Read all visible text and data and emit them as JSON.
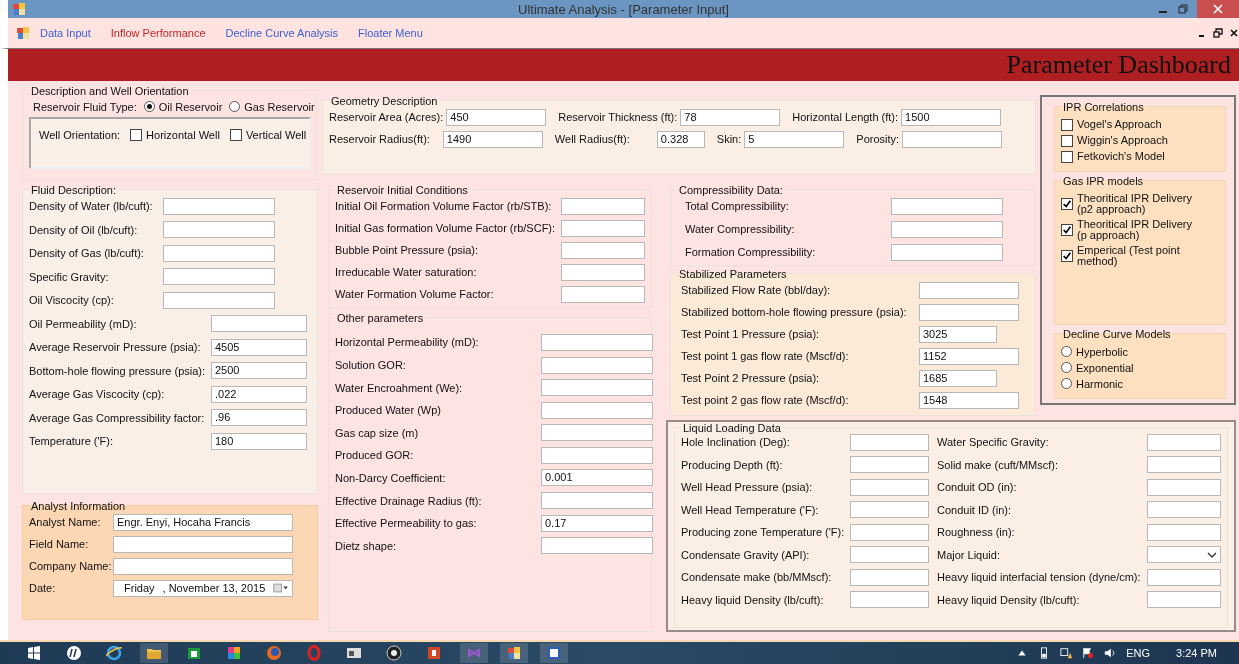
{
  "window": {
    "title": "Ultimate Analysis - [Parameter Input]"
  },
  "menu": [
    {
      "label": "Data Input",
      "selected": false
    },
    {
      "label": "Inflow Performance",
      "selected": true
    },
    {
      "label": "Decline Curve Analysis",
      "selected": false
    },
    {
      "label": "Floater Menu",
      "selected": false
    }
  ],
  "banner": {
    "title": "Parameter Dashboard"
  },
  "description": {
    "title": "Description and Well Orientation",
    "fluid_type_label": "Reservoir Fluid Type:",
    "fluid_types": [
      {
        "label": "Oil Reservoir",
        "selected": true
      },
      {
        "label": "Gas Reservoir",
        "selected": false
      }
    ],
    "orientation_label": "Well Orientation:",
    "orientations": [
      {
        "label": "Horizontal Well",
        "checked": false
      },
      {
        "label": "Vertical Well",
        "checked": false
      }
    ]
  },
  "geometry": {
    "title": "Geometry Description",
    "fields": [
      {
        "label": "Reservoir Area (Acres):",
        "value": "450"
      },
      {
        "label": "Reservoir Thickness (ft):",
        "value": "78"
      },
      {
        "label": "Horizontal Length (ft):",
        "value": "1500"
      },
      {
        "label": "Reservoir Radius(ft):",
        "value": "1490"
      },
      {
        "label": "Well Radius(ft):",
        "value": "0.328"
      },
      {
        "label": "Skin:",
        "value": "5"
      },
      {
        "label": "Porosity:"
      }
    ]
  },
  "fluid": {
    "title": "Fluid Description:",
    "fields": [
      {
        "label": "Density of Water (lb/cuft):"
      },
      {
        "label": "Density of Oil (lb/cuft):"
      },
      {
        "label": "Density of Gas (lb/cuft):"
      },
      {
        "label": "Specific Gravity:"
      },
      {
        "label": "Oil Viscocity (cp):"
      },
      {
        "label": "Oil Permeability (mD):"
      },
      {
        "label": "Average Reservoir Pressure (psia):",
        "value": "4505"
      },
      {
        "label": "Bottom-hole flowing pressure (psia):",
        "value": "2500"
      },
      {
        "label": "Average Gas Viscocity (cp):",
        "value": ".022"
      },
      {
        "label": "Average Gas Compressibility factor:",
        "value": ".96"
      },
      {
        "label": "Temperature ('F):",
        "value": "180"
      }
    ]
  },
  "analyst": {
    "title": "Analyst Information",
    "fields": [
      {
        "kind": "text",
        "label": "Analyst Name:",
        "value": "Engr. Enyi, Hocaha Francis"
      },
      {
        "kind": "text",
        "label": "Field Name:"
      },
      {
        "kind": "text",
        "label": "Company Name:"
      },
      {
        "kind": "date",
        "label": "Date:",
        "day": "Friday",
        "value": ", November 13, 2015"
      }
    ]
  },
  "reservoir_initial": {
    "title": "Reservoir Initial Conditions",
    "fields": [
      {
        "label": "Initial Oil Formation Volume Factor (rb/STB):"
      },
      {
        "label": "Initial Gas formation Volume Factor (rb/SCF):"
      },
      {
        "label": "Bubble Point Pressure (psia):"
      },
      {
        "label": "Irreducable Water saturation:"
      },
      {
        "label": "Water Formation Volume Factor:"
      }
    ]
  },
  "other_parameters": {
    "title": "Other parameters",
    "fields": [
      {
        "label": "Horizontal Permeability (mD):"
      },
      {
        "label": "Solution GOR:"
      },
      {
        "label": "Water Encroahment (We):"
      },
      {
        "label": "Produced Water (Wp)"
      },
      {
        "label": "Gas cap size (m)"
      },
      {
        "label": "Produced GOR:"
      },
      {
        "label": "Non-Darcy Coefficient:",
        "value": "0.001"
      },
      {
        "label": "Effective Drainage Radius (ft):"
      },
      {
        "label": "Effective Permeability to gas:",
        "value": "0.17"
      },
      {
        "label": "Dietz shape:"
      }
    ]
  },
  "compressibility": {
    "title": "Compressibility Data:",
    "fields": [
      {
        "label": "Total Compressibility:"
      },
      {
        "label": "Water Compressibility:"
      },
      {
        "label": "Formation Compressibility:"
      }
    ]
  },
  "stabilized": {
    "title": "Stabilized Parameters",
    "fields": [
      {
        "label": "Stabilized Flow Rate (bbl/day):"
      },
      {
        "label": "Stabilized bottom-hole flowing pressure (psia):"
      },
      {
        "label": "Test Point 1 Pressure (psia):",
        "value": "3025"
      },
      {
        "label": "Test point 1 gas flow rate (Mscf/d):",
        "value": "1152"
      },
      {
        "label": "Test Point 2 Pressure (psia):",
        "value": "1685"
      },
      {
        "label": "Test point 2 gas flow rate (Mscf/d):",
        "value": "1548"
      }
    ]
  },
  "ipr_correlations": {
    "title": "IPR Correlations",
    "items": [
      {
        "label": "Vogel's Approach",
        "checked": false
      },
      {
        "label": "Wiggin's Approach",
        "checked": false
      },
      {
        "label": "Fetkovich's Model",
        "checked": false
      }
    ]
  },
  "gas_ipr_models": {
    "title": "Gas IPR models",
    "items": [
      {
        "label": "Theoritical IPR Delivery\n(p2 approach)",
        "checked": true
      },
      {
        "label": "Theoritical IPR Delivery\n(p approach)",
        "checked": true
      },
      {
        "label": "Emperical (Test point method)",
        "checked": true
      }
    ]
  },
  "decline_curve_models": {
    "title": "Decline Curve Models",
    "options": [
      {
        "label": "Hyperbolic",
        "selected": false
      },
      {
        "label": "Exponential",
        "selected": false
      },
      {
        "label": "Harmonic",
        "selected": false
      }
    ]
  },
  "liquid_loading": {
    "title": "Liquid Loading Data",
    "left": [
      {
        "kind": "text",
        "label": "Hole Inclination (Deg):"
      },
      {
        "kind": "text",
        "label": "Producing Depth (ft):"
      },
      {
        "kind": "text",
        "label": "Well Head Pressure (psia):"
      },
      {
        "kind": "text",
        "label": "Well Head Temperature ('F):"
      },
      {
        "kind": "text",
        "label": "Producing zone Temperature ('F):"
      },
      {
        "kind": "text",
        "label": "Condensate Gravity (API):"
      },
      {
        "kind": "text",
        "label": "Condensate make (bb/MMscf):"
      },
      {
        "kind": "text",
        "label": "Heavy liquid Density (lb/cuft):"
      }
    ],
    "right": [
      {
        "kind": "text",
        "label": "Water Specific Gravity:"
      },
      {
        "kind": "text",
        "label": "Solid make (cuft/MMscf):"
      },
      {
        "kind": "text",
        "label": "Conduit OD (in):"
      },
      {
        "kind": "text",
        "label": "Conduit ID (in):"
      },
      {
        "kind": "text",
        "label": "Roughness (in):"
      },
      {
        "kind": "select",
        "label": "Major Liquid:"
      },
      {
        "kind": "text",
        "label": "Heavy liquid interfacial tension (dyne/cm):"
      },
      {
        "kind": "text",
        "label": "Heavy liquid Density (lb/cuft):"
      }
    ]
  },
  "taskbar": {
    "language": "ENG",
    "time": "3:24 PM"
  }
}
